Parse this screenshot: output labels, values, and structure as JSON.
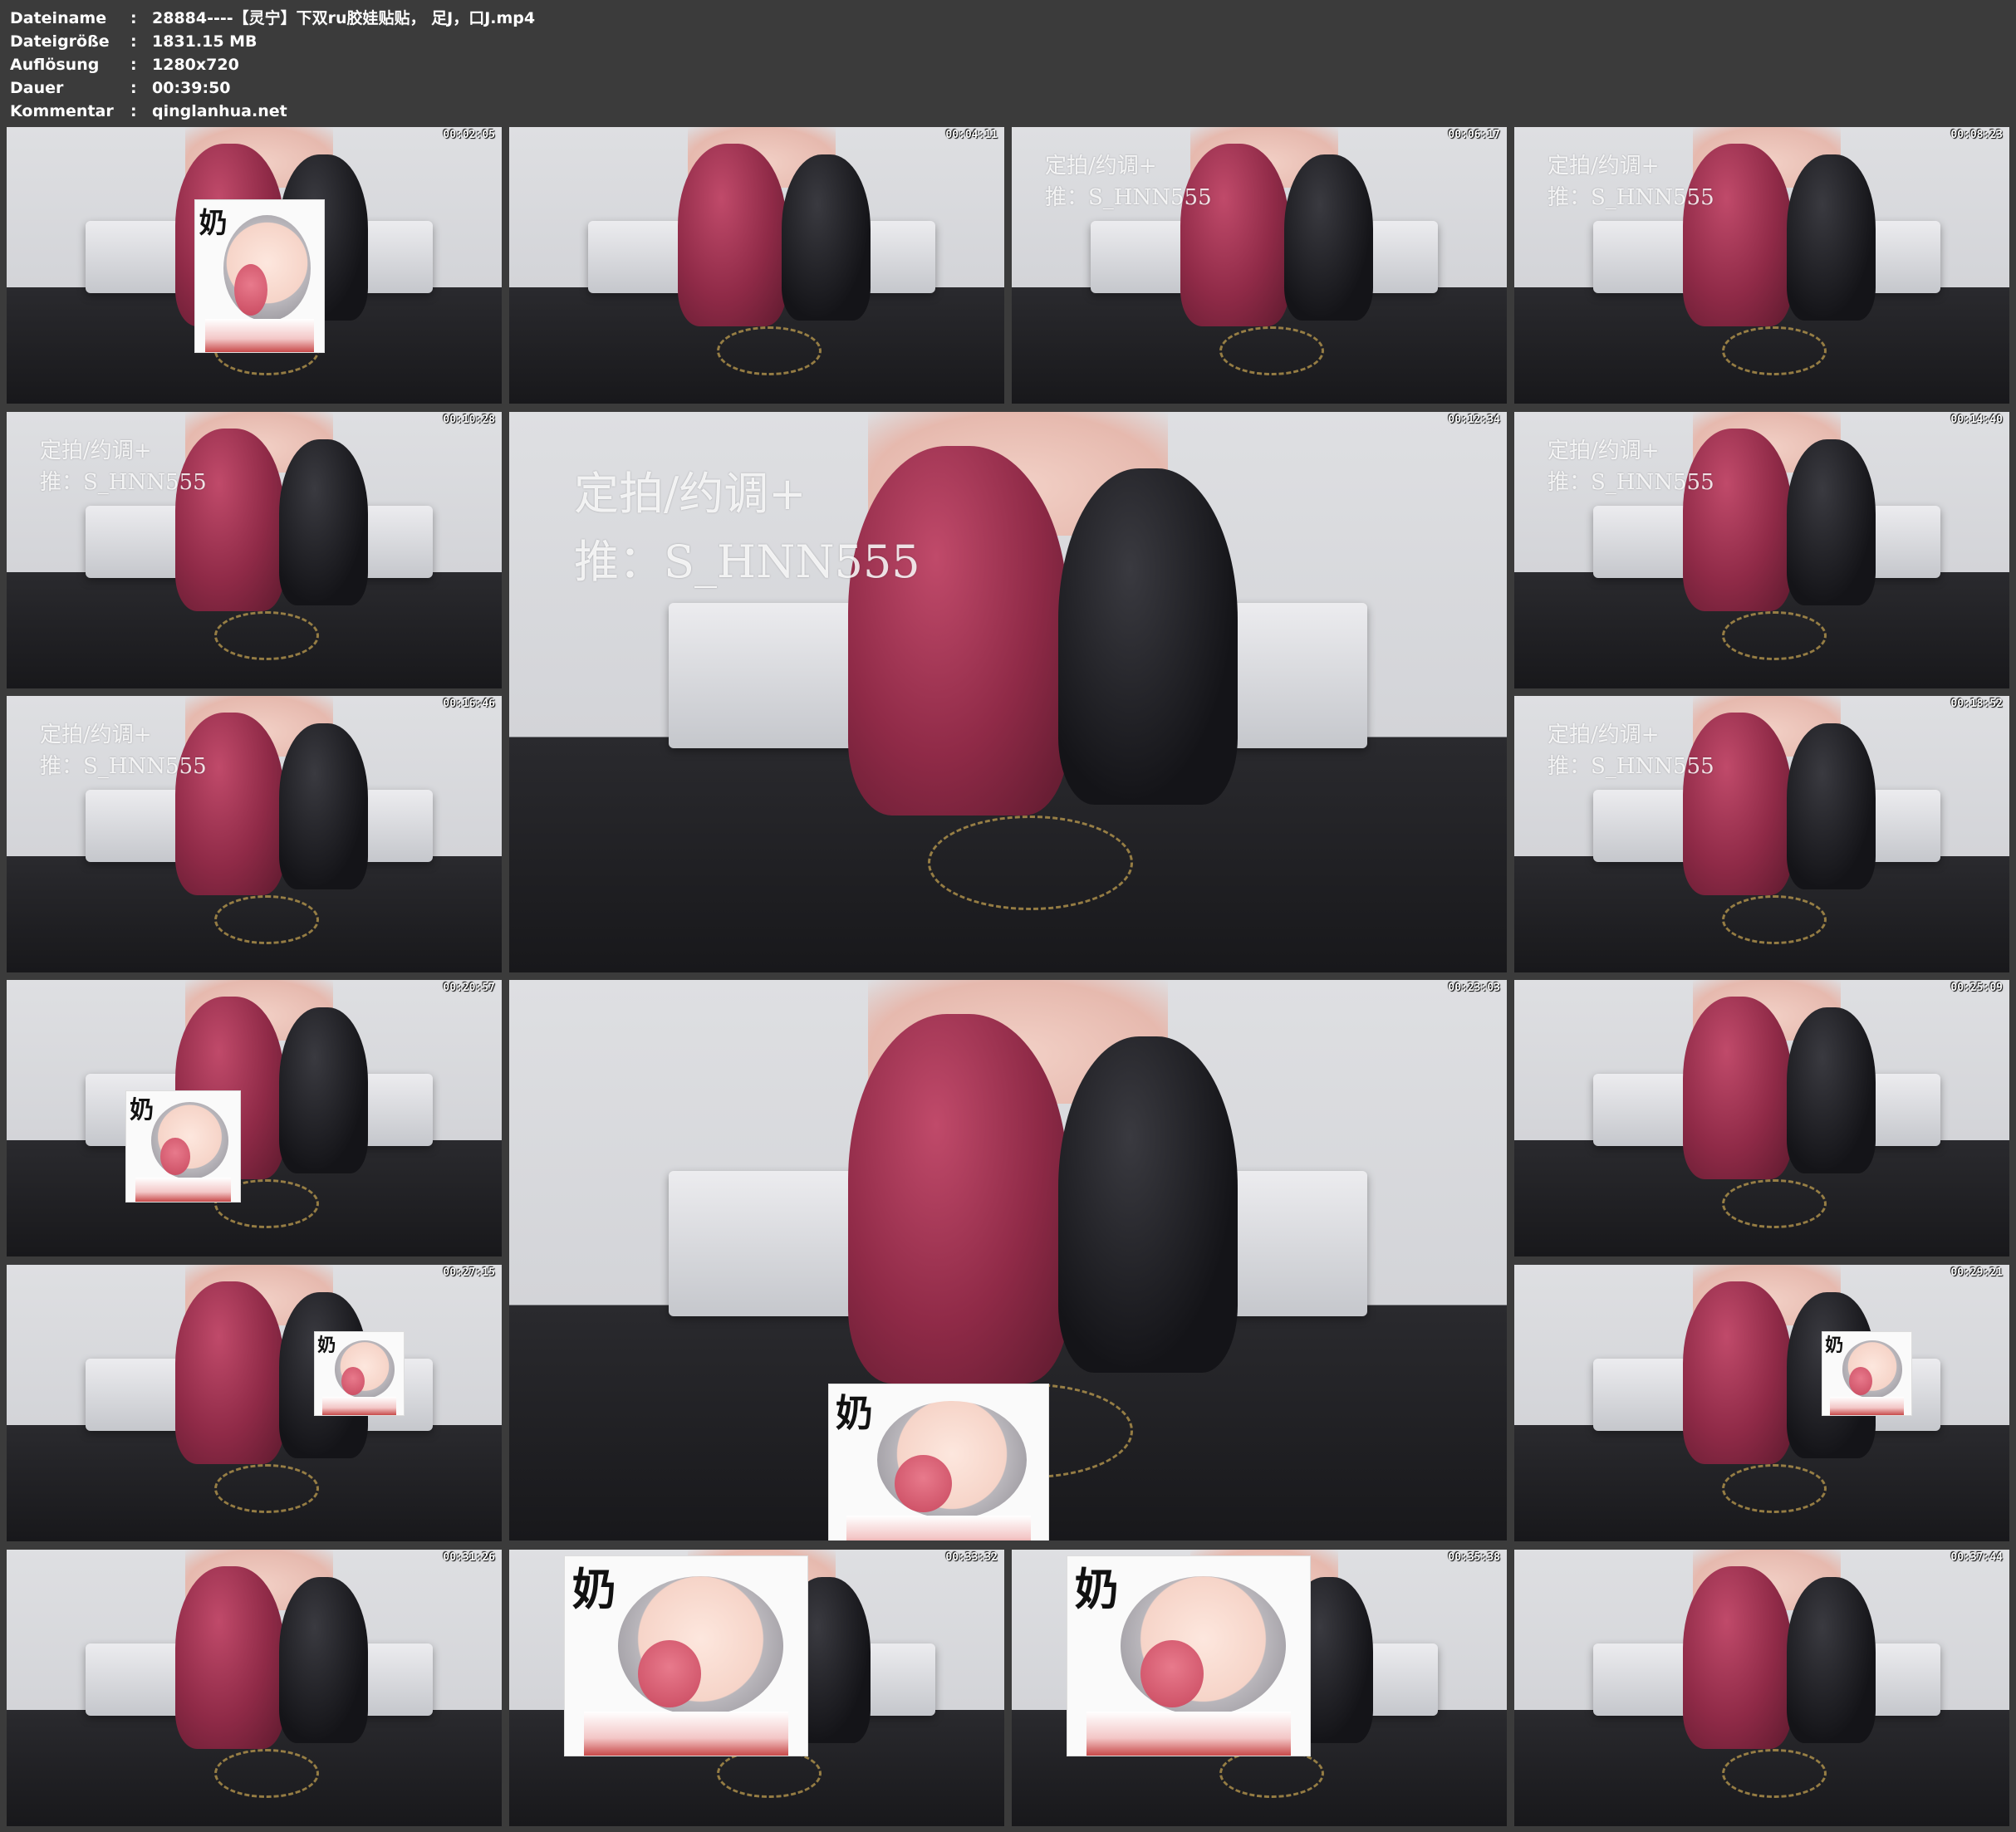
{
  "info": [
    {
      "key": "Dateiname",
      "value": "28884----【灵宁】下双ru胶娃贴贴， 足J，口J.mp4"
    },
    {
      "key": "Dateigröße",
      "value": "1831.15 MB"
    },
    {
      "key": "Auflösung",
      "value": "1280x720"
    },
    {
      "key": "Dauer",
      "value": "00:39:50"
    },
    {
      "key": "Kommentar",
      "value": "qinglanhua.net"
    }
  ],
  "separator": ":",
  "watermark": {
    "line1": "定拍/约调+",
    "line2": "推：S_HNN555"
  },
  "sticker_glyph": "奶",
  "thumbnails": [
    {
      "timestamp": "00:02:05"
    },
    {
      "timestamp": "00:04:11"
    },
    {
      "timestamp": "00:06:17"
    },
    {
      "timestamp": "00:08:23"
    },
    {
      "timestamp": "00:10:28"
    },
    {
      "timestamp": "00:12:34"
    },
    {
      "timestamp": "00:14:40"
    },
    {
      "timestamp": "00:16:46"
    },
    {
      "timestamp": "00:18:52"
    },
    {
      "timestamp": "00:20:57"
    },
    {
      "timestamp": "00:23:03"
    },
    {
      "timestamp": "00:25:09"
    },
    {
      "timestamp": "00:27:15"
    },
    {
      "timestamp": "00:29:21"
    },
    {
      "timestamp": "00:31:26"
    },
    {
      "timestamp": "00:33:32"
    },
    {
      "timestamp": "00:35:38"
    },
    {
      "timestamp": "00:37:44"
    }
  ]
}
